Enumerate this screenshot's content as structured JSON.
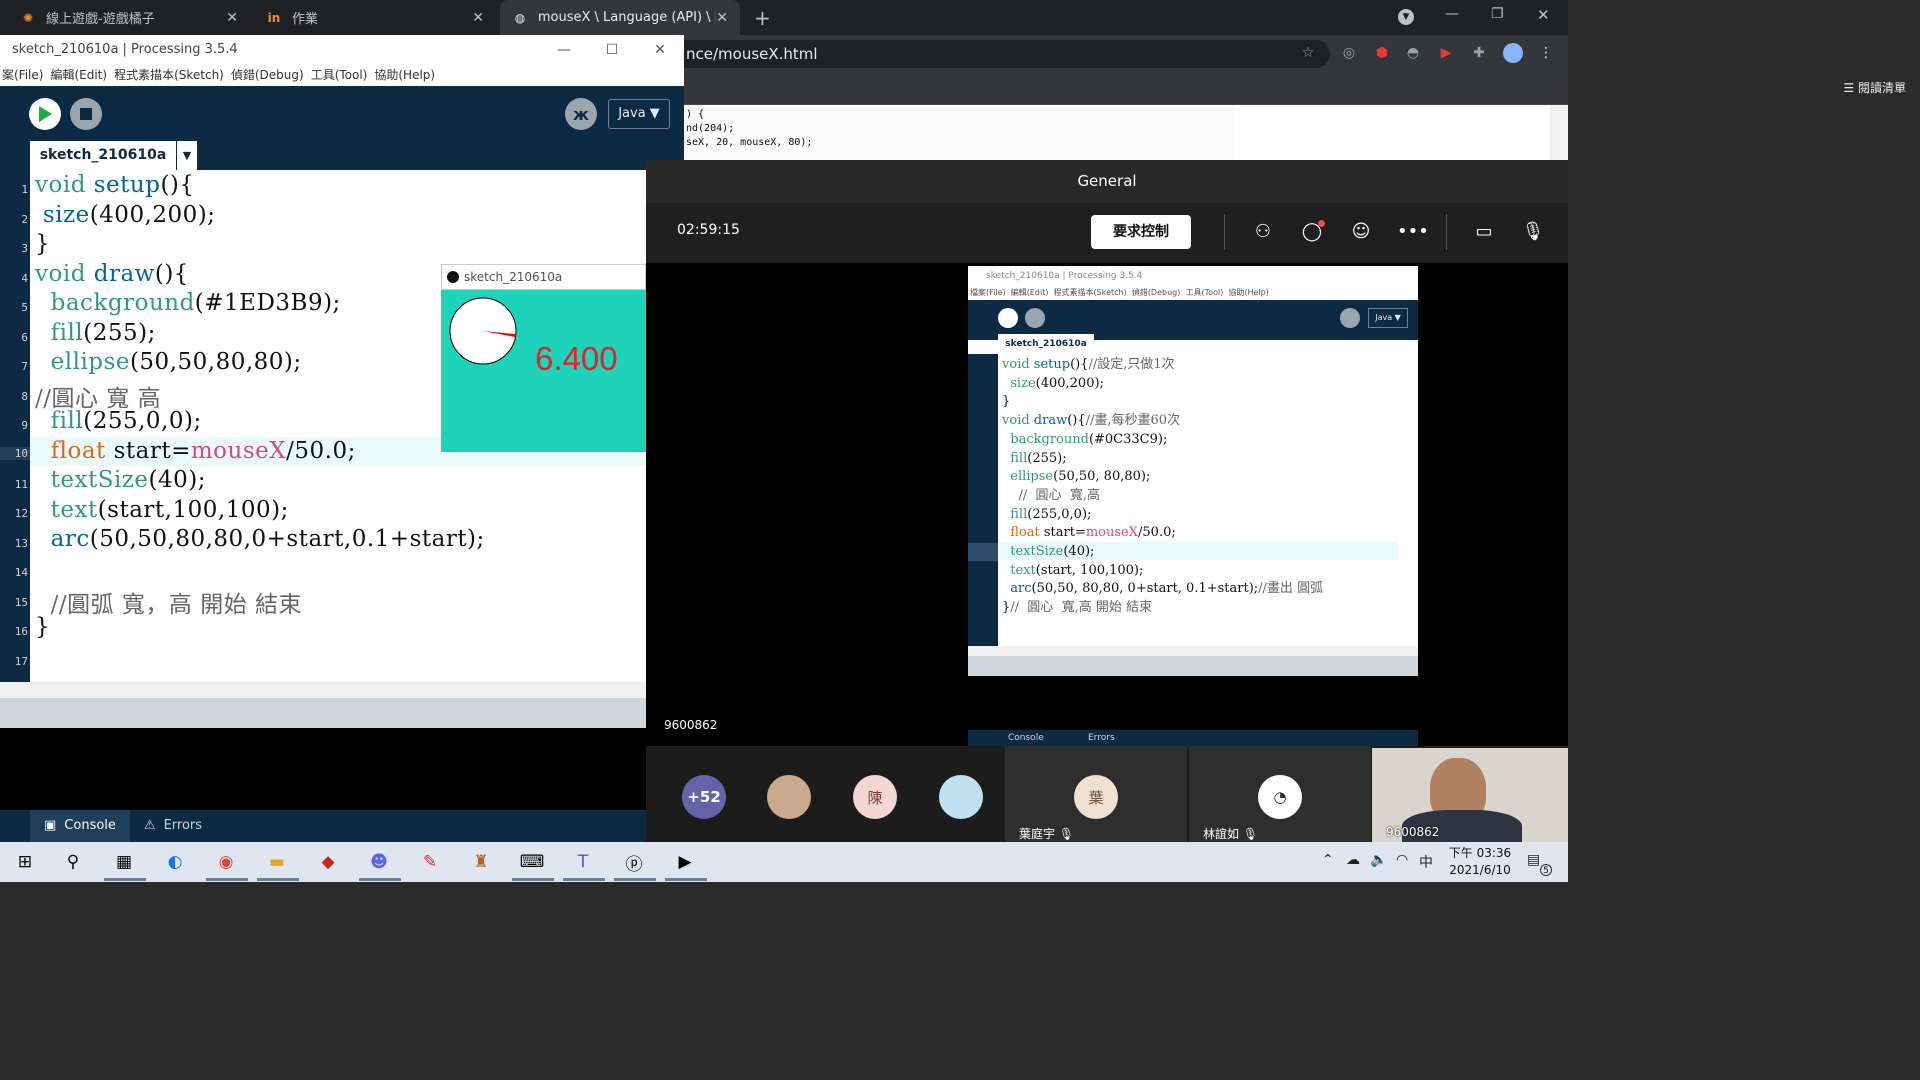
{
  "browser": {
    "tabs": [
      {
        "label": "線上遊戲-遊戲橘子"
      },
      {
        "label": "作業"
      },
      {
        "label": "mouseX \\ Language (API) \\ Pro"
      }
    ],
    "new_tab": "+",
    "url": "nce/mouseX.html",
    "reading_list": "閱讀清單",
    "page_code": [
      ") {",
      "nd(204);",
      "seX, 20, mouseX, 80);"
    ]
  },
  "processing": {
    "title": "sketch_210610a | Processing 3.5.4",
    "menu": [
      "案(File)",
      "編輯(Edit)",
      "程式素描本(Sketch)",
      "偵錯(Debug)",
      "工具(Tool)",
      "協助(Help)"
    ],
    "mode": "Java ▼",
    "tab_name": "sketch_210610a",
    "line_numbers": [
      "1",
      "2",
      "3",
      "4",
      "5",
      "6",
      "7",
      "8",
      "9",
      "10",
      "11",
      "12",
      "13",
      "14",
      "15",
      "16",
      "17"
    ],
    "console_tab": "Console",
    "errors_tab": "Errors"
  },
  "sketch_window": {
    "title": "sketch_210610a",
    "output_text": "6.400",
    "background": "#1ED3B9",
    "text_color": "#ff0000"
  },
  "teams": {
    "channel": "General",
    "timer": "02:59:15",
    "request_control": "要求控制",
    "share_label": "9600862",
    "shared": {
      "title": "sketch_210610a | Processing 3.5.4",
      "menu": "檔案(File)  編輯(Edit)  程式素描本(Sketch)  偵錯(Debug)  工具(Tool)  協助(Help)",
      "tab": "sketch_210610a",
      "mode": "Java ▼",
      "console": "Console",
      "errors": "Errors"
    },
    "overflow_count": "+52",
    "avatar_chen": "陳",
    "avatar_ye": "葉",
    "name_ye": "葉庭宇",
    "name_lin": "林誼如",
    "camera_label": "9600862"
  },
  "taskbar": {
    "time": "下午 03:36",
    "date": "2021/6/10",
    "ime": "中",
    "notification_count": "5"
  }
}
